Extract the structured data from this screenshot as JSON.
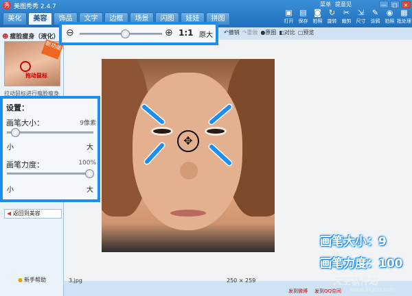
{
  "app": {
    "title": "美图秀秀 2.4.7",
    "logo": "秀"
  },
  "tabs": [
    "美化",
    "美容",
    "饰品",
    "文字",
    "边框",
    "场景",
    "闪图",
    "娃娃",
    "拼图"
  ],
  "active_tab": 1,
  "topmenu": {
    "menu": "菜单",
    "feedback": "提意见"
  },
  "window_controls": {
    "minimize": "—",
    "maximize": "□",
    "close": "×"
  },
  "toolbar": {
    "items": [
      {
        "icon": "open-icon",
        "glyph": "▣",
        "label": "打开"
      },
      {
        "icon": "save-icon",
        "glyph": "▤",
        "label": "保存"
      },
      {
        "icon": "camera-icon",
        "glyph": "◙",
        "label": "拍照"
      },
      {
        "icon": "rotate-icon",
        "glyph": "↻",
        "label": "旋转"
      },
      {
        "icon": "crop-icon",
        "glyph": "✂",
        "label": "裁剪"
      },
      {
        "icon": "resize-icon",
        "glyph": "⇲",
        "label": "尺寸"
      },
      {
        "icon": "brush-icon",
        "glyph": "✎",
        "label": "涂鸦"
      },
      {
        "icon": "snapshot-icon",
        "glyph": "◉",
        "label": "拍照"
      },
      {
        "icon": "batch-icon",
        "glyph": "▦",
        "label": "批处理"
      }
    ]
  },
  "left_panel": {
    "tool_title": "瘦脸瘦身（液化）",
    "new_badge": "新功能",
    "preview_caption": "拖动鼠标",
    "hint": "拉动鼠标进行瘦脸瘦身",
    "back_button": "返回到美容",
    "help": "新手帮助"
  },
  "settings": {
    "title": "设置：",
    "brush_size": {
      "label": "画笔大小：",
      "value_text": "9像素",
      "value": 9,
      "min_label": "小",
      "max_label": "大",
      "fraction": 0.1
    },
    "brush_strength": {
      "label": "画笔力度：",
      "value_text": "100%",
      "value": 100,
      "min_label": "小",
      "max_label": "大",
      "fraction": 1.0
    }
  },
  "zoom": {
    "ratio": "1:1",
    "label": "原大",
    "fraction": 0.55
  },
  "edit_tools": [
    {
      "icon": "undo-icon",
      "glyph": "↶",
      "label": "撤销",
      "enabled": true
    },
    {
      "icon": "redo-icon",
      "glyph": "↷",
      "label": "重做",
      "enabled": false
    },
    {
      "icon": "original-icon",
      "glyph": "●",
      "label": "原图",
      "enabled": true
    },
    {
      "icon": "compare-icon",
      "glyph": "◧",
      "label": "对比",
      "enabled": true
    },
    {
      "icon": "preview-icon",
      "glyph": "▢",
      "label": "预览",
      "enabled": true
    }
  ],
  "status": {
    "filename": "3.jpg",
    "image_size": "250 × 259"
  },
  "bottom_links": [
    "发到微博",
    "发到QQ空间"
  ],
  "annotations": {
    "brush_size": "画笔大小：9",
    "brush_strength": "画笔力度：100"
  },
  "watermark": {
    "text": "天空软件站",
    "url": "www.Skycn.com"
  },
  "colors": {
    "accent": "#1c8ef0",
    "title_bar": "#2a7cc8"
  }
}
